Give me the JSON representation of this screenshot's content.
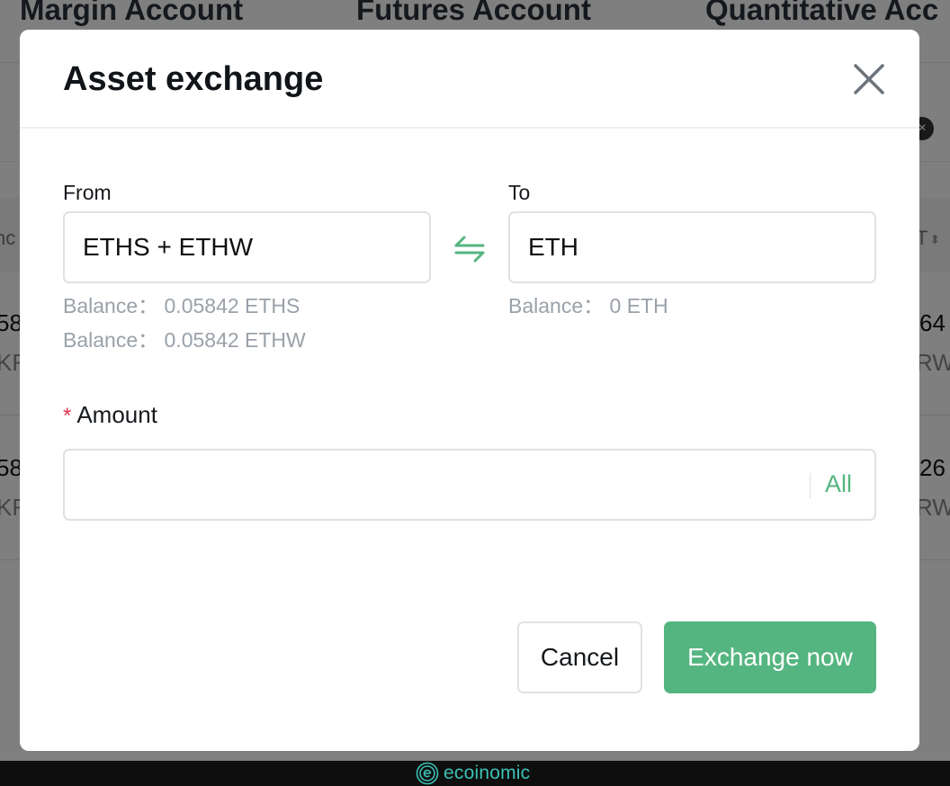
{
  "background": {
    "tabs": [
      "Margin Account",
      "Futures Account",
      "Quantitative Acc"
    ],
    "header_left_fragment": "nc",
    "header_right_fragment": "T",
    "rows": [
      {
        "left_value": "58",
        "left_sub": "KF",
        "right_value": "64",
        "right_sub": "RW"
      },
      {
        "left_value": "58",
        "left_sub": "KF",
        "right_value": "26",
        "right_sub": "RW"
      }
    ]
  },
  "modal": {
    "title": "Asset exchange",
    "close_icon": "close-icon",
    "from": {
      "label": "From",
      "value": "ETHS + ETHW",
      "balances": [
        "Balance： 0.05842 ETHS",
        "Balance： 0.05842 ETHW"
      ]
    },
    "swap_icon": "swap-arrows-icon",
    "to": {
      "label": "To",
      "value": "ETH",
      "balances": [
        "Balance： 0 ETH"
      ]
    },
    "amount": {
      "required_mark": "*",
      "label": "Amount",
      "value": "",
      "placeholder": "",
      "all_label": "All"
    },
    "buttons": {
      "cancel": "Cancel",
      "exchange": "Exchange now"
    }
  },
  "colors": {
    "accent": "#55b580",
    "required": "#e0344f",
    "muted_text": "#9aa1a9",
    "watermark": "#3bc0b4"
  },
  "watermark": {
    "text": "ecoinomic"
  }
}
